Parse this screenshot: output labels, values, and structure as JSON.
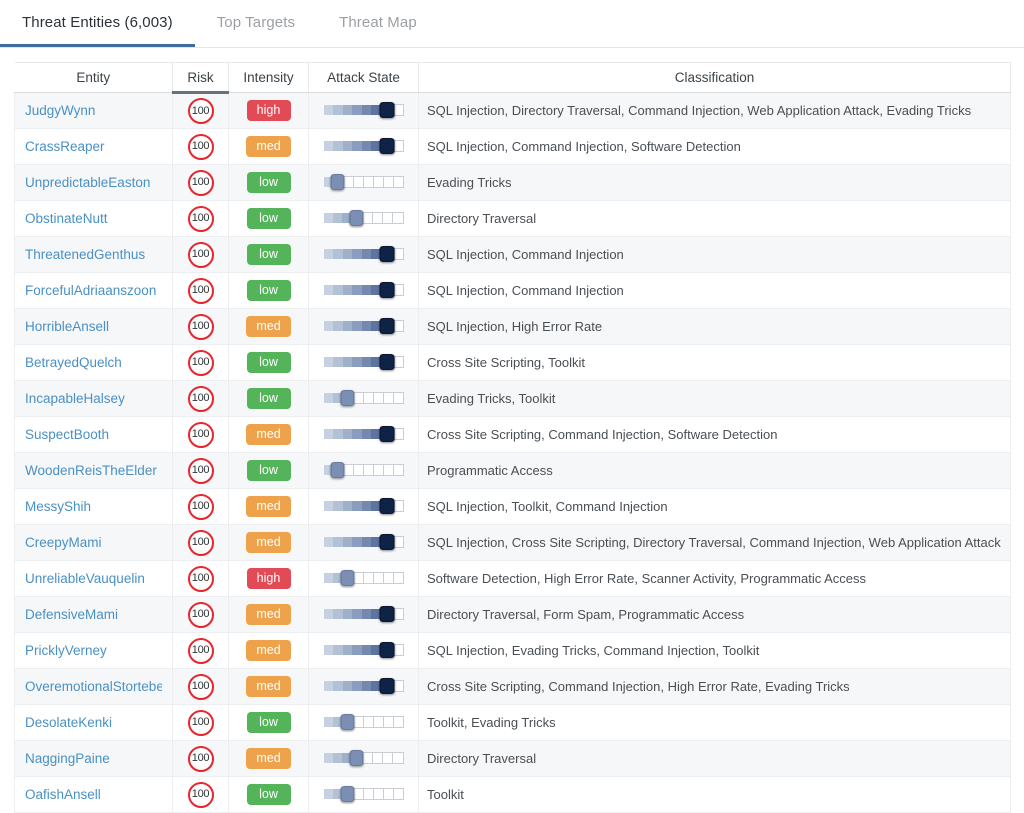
{
  "tabs": [
    {
      "label": "Threat Entities (6,003)",
      "active": true
    },
    {
      "label": "Top Targets",
      "active": false
    },
    {
      "label": "Threat Map",
      "active": false
    }
  ],
  "table": {
    "columns": [
      {
        "label": "Entity",
        "sorted": false
      },
      {
        "label": "Risk",
        "sorted": true
      },
      {
        "label": "Intensity",
        "sorted": false
      },
      {
        "label": "Attack State",
        "sorted": false
      },
      {
        "label": "Classification",
        "sorted": false
      }
    ],
    "segments_total": 8,
    "colors": {
      "high": "#e24b56",
      "med": "#efa24c",
      "low": "#54b45a",
      "risk_ring": "#e8262d",
      "link": "#4a90c4",
      "accent": "#3b6e9e",
      "knob_dark": "#0f2347",
      "knob_light": "#7b8fb5"
    },
    "rows": [
      {
        "entity": "JudgyWynn",
        "risk": "100",
        "intensity": "high",
        "attack_level": 7,
        "classification": "SQL Injection, Directory Traversal, Command Injection, Web Application Attack, Evading Tricks"
      },
      {
        "entity": "CrassReaper",
        "risk": "100",
        "intensity": "med",
        "attack_level": 7,
        "classification": "SQL Injection, Command Injection, Software Detection"
      },
      {
        "entity": "UnpredictableEaston",
        "risk": "100",
        "intensity": "low",
        "attack_level": 2,
        "classification": "Evading Tricks"
      },
      {
        "entity": "ObstinateNutt",
        "risk": "100",
        "intensity": "low",
        "attack_level": 4,
        "classification": "Directory Traversal"
      },
      {
        "entity": "ThreatenedGenthus",
        "risk": "100",
        "intensity": "low",
        "attack_level": 7,
        "classification": "SQL Injection, Command Injection"
      },
      {
        "entity": "ForcefulAdriaanszoon",
        "risk": "100",
        "intensity": "low",
        "attack_level": 7,
        "classification": "SQL Injection, Command Injection"
      },
      {
        "entity": "HorribleAnsell",
        "risk": "100",
        "intensity": "med",
        "attack_level": 7,
        "classification": "SQL Injection, High Error Rate"
      },
      {
        "entity": "BetrayedQuelch",
        "risk": "100",
        "intensity": "low",
        "attack_level": 7,
        "classification": "Cross Site Scripting, Toolkit"
      },
      {
        "entity": "IncapableHalsey",
        "risk": "100",
        "intensity": "low",
        "attack_level": 3,
        "classification": "Evading Tricks, Toolkit"
      },
      {
        "entity": "SuspectBooth",
        "risk": "100",
        "intensity": "med",
        "attack_level": 7,
        "classification": "Cross Site Scripting, Command Injection, Software Detection"
      },
      {
        "entity": "WoodenReisTheElder",
        "risk": "100",
        "intensity": "low",
        "attack_level": 2,
        "classification": "Programmatic Access"
      },
      {
        "entity": "MessyShih",
        "risk": "100",
        "intensity": "med",
        "attack_level": 7,
        "classification": "SQL Injection, Toolkit, Command Injection"
      },
      {
        "entity": "CreepyMami",
        "risk": "100",
        "intensity": "med",
        "attack_level": 7,
        "classification": "SQL Injection, Cross Site Scripting, Directory Traversal, Command Injection, Web Application Attack"
      },
      {
        "entity": "UnreliableVauquelin",
        "risk": "100",
        "intensity": "high",
        "attack_level": 3,
        "classification": "Software Detection, High Error Rate, Scanner Activity, Programmatic Access"
      },
      {
        "entity": "DefensiveMami",
        "risk": "100",
        "intensity": "med",
        "attack_level": 7,
        "classification": "Directory Traversal, Form Spam, Programmatic Access"
      },
      {
        "entity": "PricklyVerney",
        "risk": "100",
        "intensity": "med",
        "attack_level": 7,
        "classification": "SQL Injection, Evading Tricks, Command Injection, Toolkit"
      },
      {
        "entity": "OveremotionalStortebe",
        "risk": "100",
        "intensity": "med",
        "attack_level": 7,
        "classification": "Cross Site Scripting, Command Injection, High Error Rate, Evading Tricks"
      },
      {
        "entity": "DesolateKenki",
        "risk": "100",
        "intensity": "low",
        "attack_level": 3,
        "classification": "Toolkit, Evading Tricks"
      },
      {
        "entity": "NaggingPaine",
        "risk": "100",
        "intensity": "med",
        "attack_level": 4,
        "classification": "Directory Traversal"
      },
      {
        "entity": "OafishAnsell",
        "risk": "100",
        "intensity": "low",
        "attack_level": 3,
        "classification": "Toolkit"
      }
    ]
  }
}
